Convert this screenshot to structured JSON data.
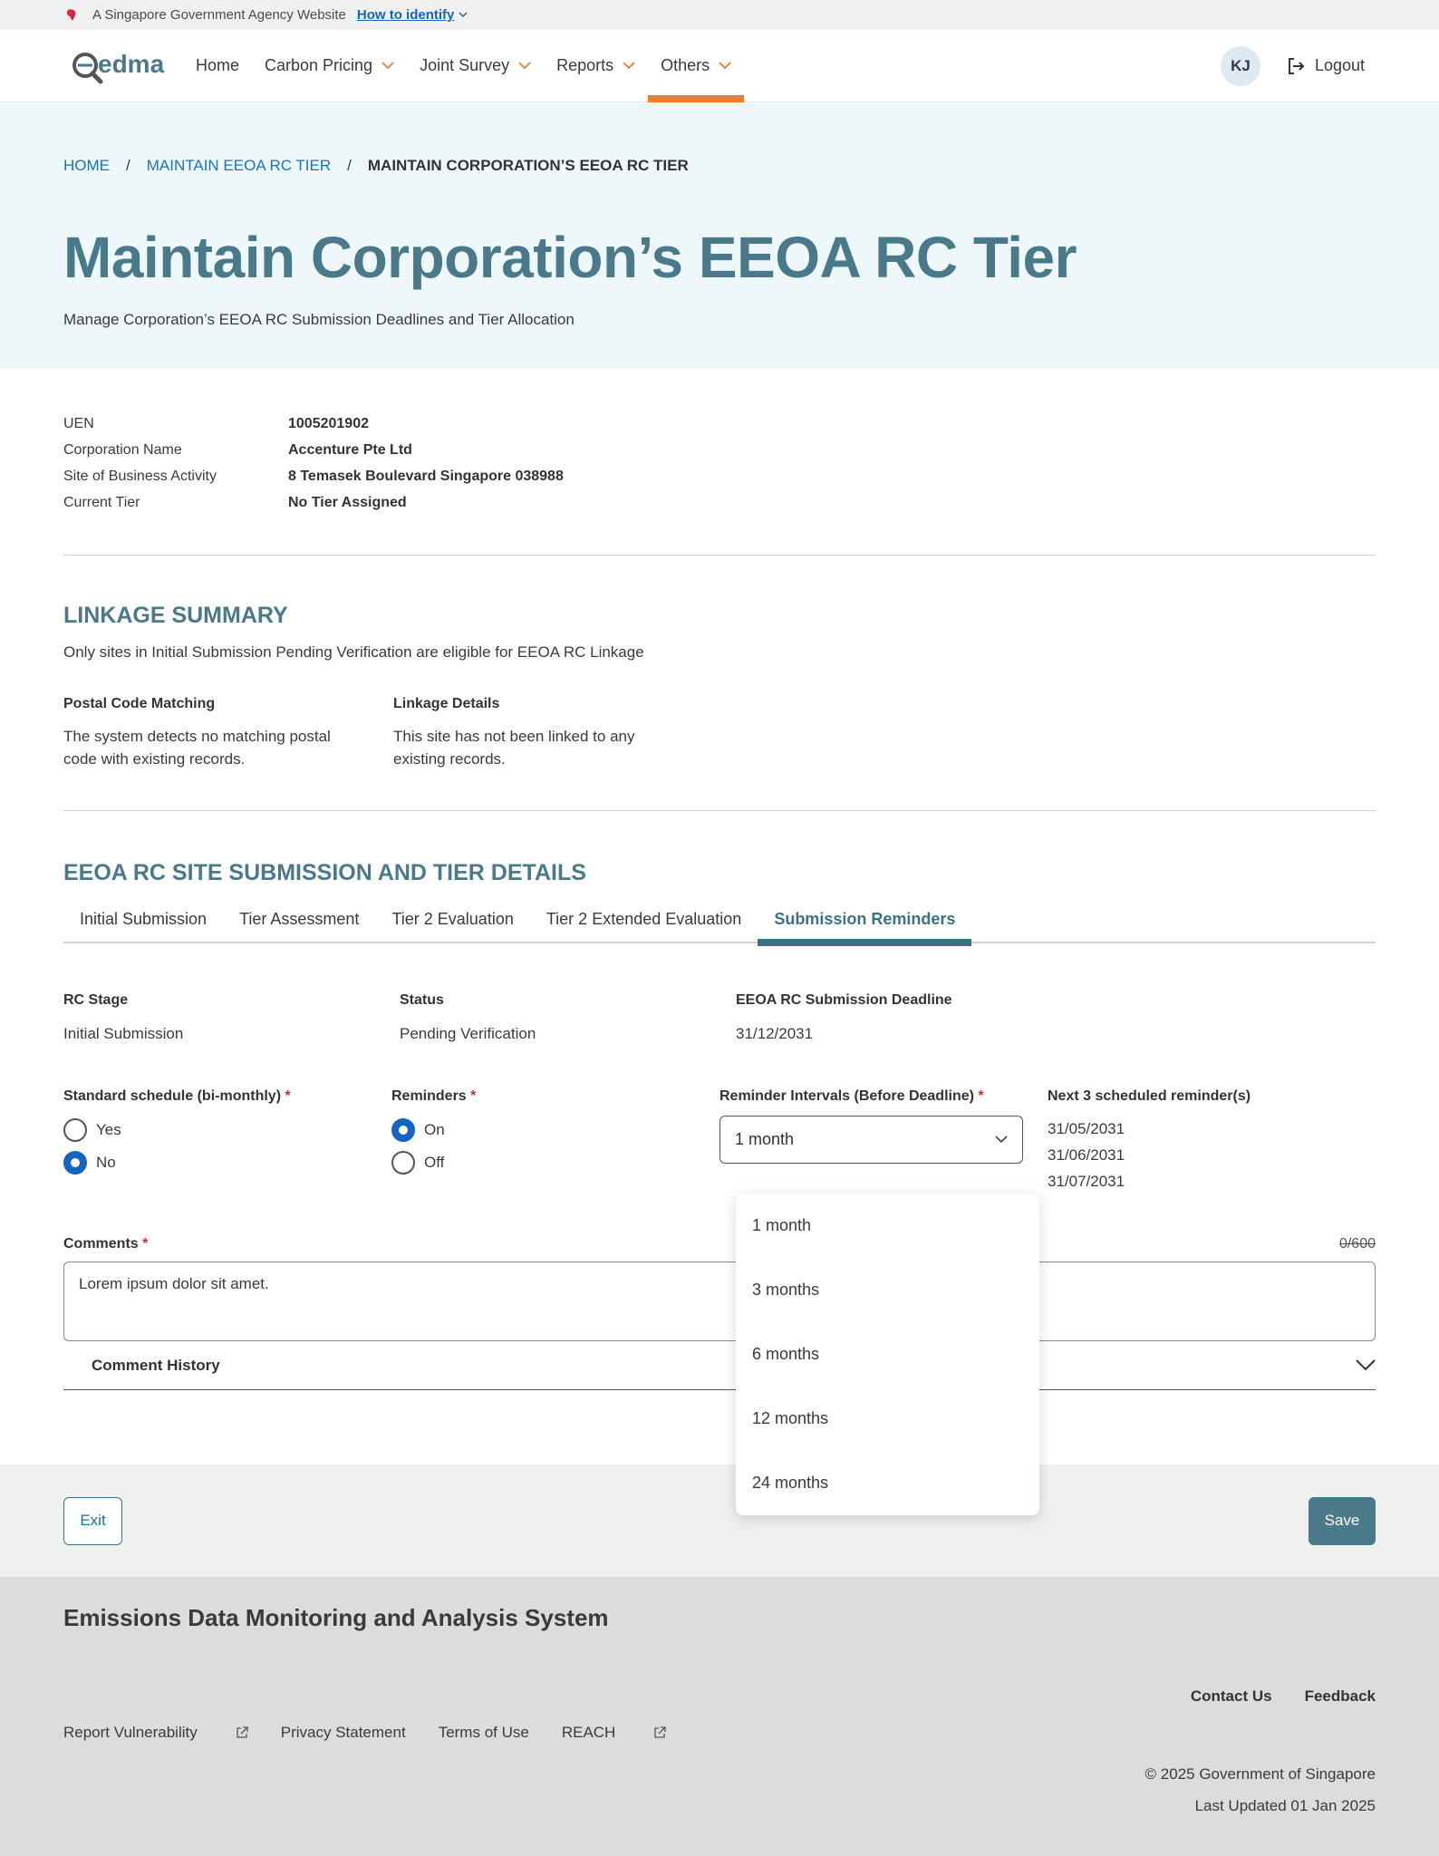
{
  "masthead": {
    "text": "A Singapore Government Agency Website",
    "how_to_identify": "How to identify"
  },
  "nav": {
    "logo_text": "edma",
    "items": [
      {
        "label": "Home"
      },
      {
        "label": "Carbon Pricing"
      },
      {
        "label": "Joint Survey"
      },
      {
        "label": "Reports"
      },
      {
        "label": "Others"
      }
    ],
    "active": "Others",
    "avatar_initials": "KJ",
    "logout": "Logout"
  },
  "breadcrumb": {
    "home": "HOME",
    "parent": "MAINTAIN EEOA RC TIER",
    "current": "MAINTAIN CORPORATION’S EEOA RC TIER"
  },
  "hero": {
    "title": "Maintain Corporation’s EEOA RC Tier",
    "subtitle": "Manage Corporation’s EEOA RC Submission Deadlines and Tier Allocation"
  },
  "info": {
    "rows": [
      {
        "label": "UEN",
        "value": "1005201902"
      },
      {
        "label": "Corporation Name",
        "value": "Accenture Pte Ltd"
      },
      {
        "label": "Site of Business Activity",
        "value": "8 Temasek Boulevard Singapore 038988"
      },
      {
        "label": "Current Tier",
        "value": "No Tier Assigned"
      }
    ]
  },
  "linkage": {
    "title": "LINKAGE SUMMARY",
    "note": "Only sites in Initial Submission Pending Verification are eligible for EEOA RC Linkage",
    "postal_heading": "Postal Code Matching",
    "postal_text": "The system detects no matching postal code with existing records.",
    "details_heading": "Linkage Details",
    "details_text": "This site has not been linked to any existing records."
  },
  "tier_section": {
    "title": "EEOA RC SITE SUBMISSION AND TIER DETAILS",
    "tabs": [
      {
        "label": "Initial Submission"
      },
      {
        "label": "Tier Assessment"
      },
      {
        "label": "Tier 2 Evaluation"
      },
      {
        "label": "Tier 2 Extended Evaluation"
      },
      {
        "label": "Submission Reminders"
      }
    ],
    "active_tab": "Submission Reminders"
  },
  "summary": {
    "rc_stage_label": "RC Stage",
    "rc_stage_value": "Initial Submission",
    "status_label": "Status",
    "status_value": "Pending Verification",
    "deadline_label": "EEOA RC Submission Deadline",
    "deadline_value": "31/12/2031"
  },
  "form": {
    "schedule_label": "Standard schedule (bi-monthly)",
    "schedule_options": [
      "Yes",
      "No"
    ],
    "schedule_selected": "No",
    "reminders_label": "Reminders",
    "reminders_options": [
      "On",
      "Off"
    ],
    "reminders_selected": "On",
    "interval_label": "Reminder Intervals (Before Deadline)",
    "interval_value": "1 month",
    "interval_options": [
      "1 month",
      "3 months",
      "6 months",
      "12 months",
      "24 months"
    ],
    "next_label": "Next 3 scheduled reminder(s)",
    "next_dates": [
      "31/05/2031",
      "31/06/2031",
      "31/07/2031"
    ],
    "required_mark": "*"
  },
  "comments": {
    "label": "Comments",
    "counter": "0/600",
    "value": "Lorem ipsum dolor sit amet.",
    "history_label": "Comment History"
  },
  "actions": {
    "exit": "Exit",
    "save": "Save"
  },
  "footer": {
    "title": "Emissions Data Monitoring and Analysis System",
    "contact": "Contact Us",
    "feedback": "Feedback",
    "links": [
      "Report Vulnerability",
      "Privacy Statement",
      "Terms of Use",
      "REACH"
    ],
    "copyright": "© 2025 Government of Singapore",
    "updated": "Last Updated 01 Jan 2025"
  },
  "colors": {
    "accent_orange": "#f07d2a",
    "teal": "#4a7a8a",
    "link_blue": "#1a73b8",
    "radio_blue": "#1565c0",
    "required_red": "#d32f2f"
  }
}
